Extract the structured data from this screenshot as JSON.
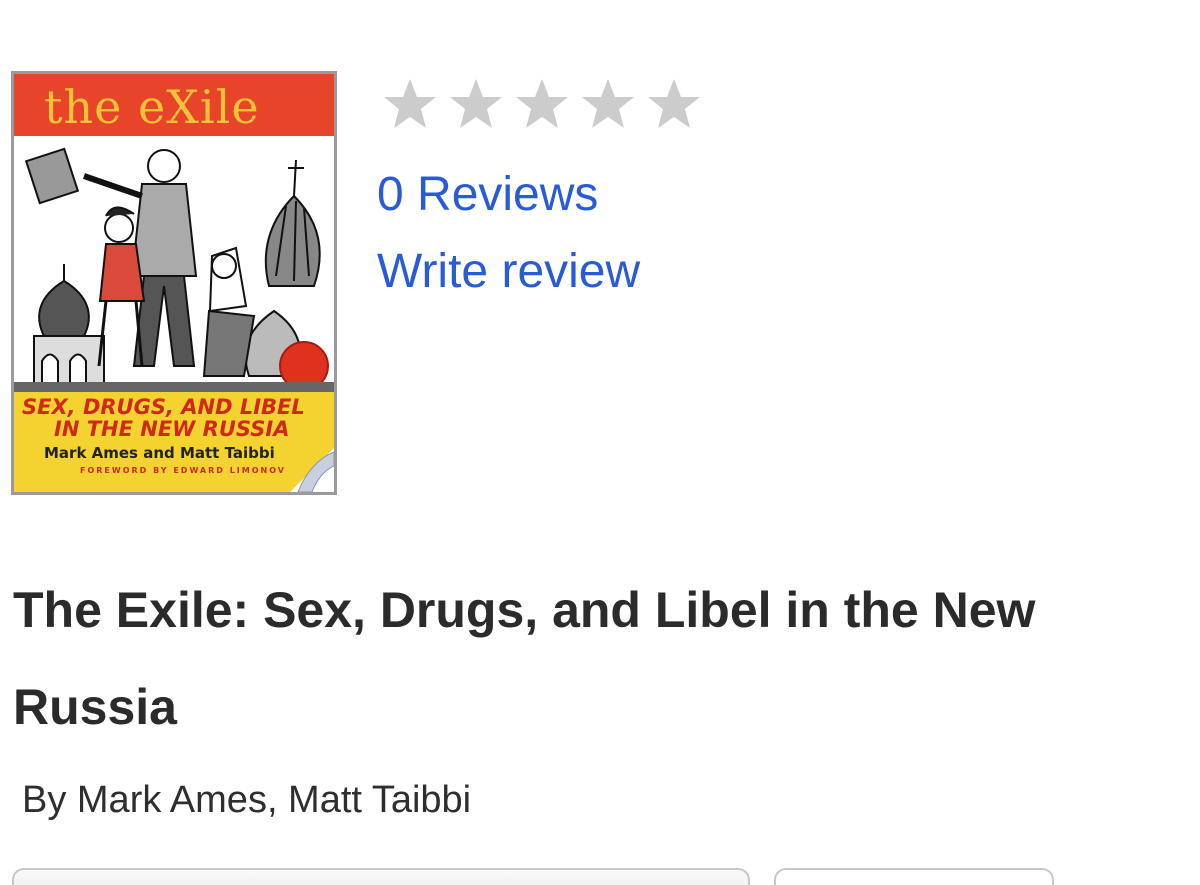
{
  "book": {
    "cover": {
      "logo_text": "the eXile",
      "subtitle_line1": "SEX, DRUGS, AND LIBEL",
      "subtitle_line2": "IN THE NEW RUSSIA",
      "authors": "Mark Ames and Matt Taibbi",
      "foreword": "FOREWORD BY EDWARD LIMONOV"
    },
    "title": "The Exile: Sex, Drugs, and Libel in the New Russia",
    "byline": "By Mark Ames, Matt Taibbi"
  },
  "rating": {
    "value": 0,
    "max": 5,
    "star_empty_color": "#cccccc",
    "icon": "star-icon"
  },
  "links": {
    "reviews": "0 Reviews",
    "write_review": "Write review",
    "color": "#2a5bd7"
  }
}
